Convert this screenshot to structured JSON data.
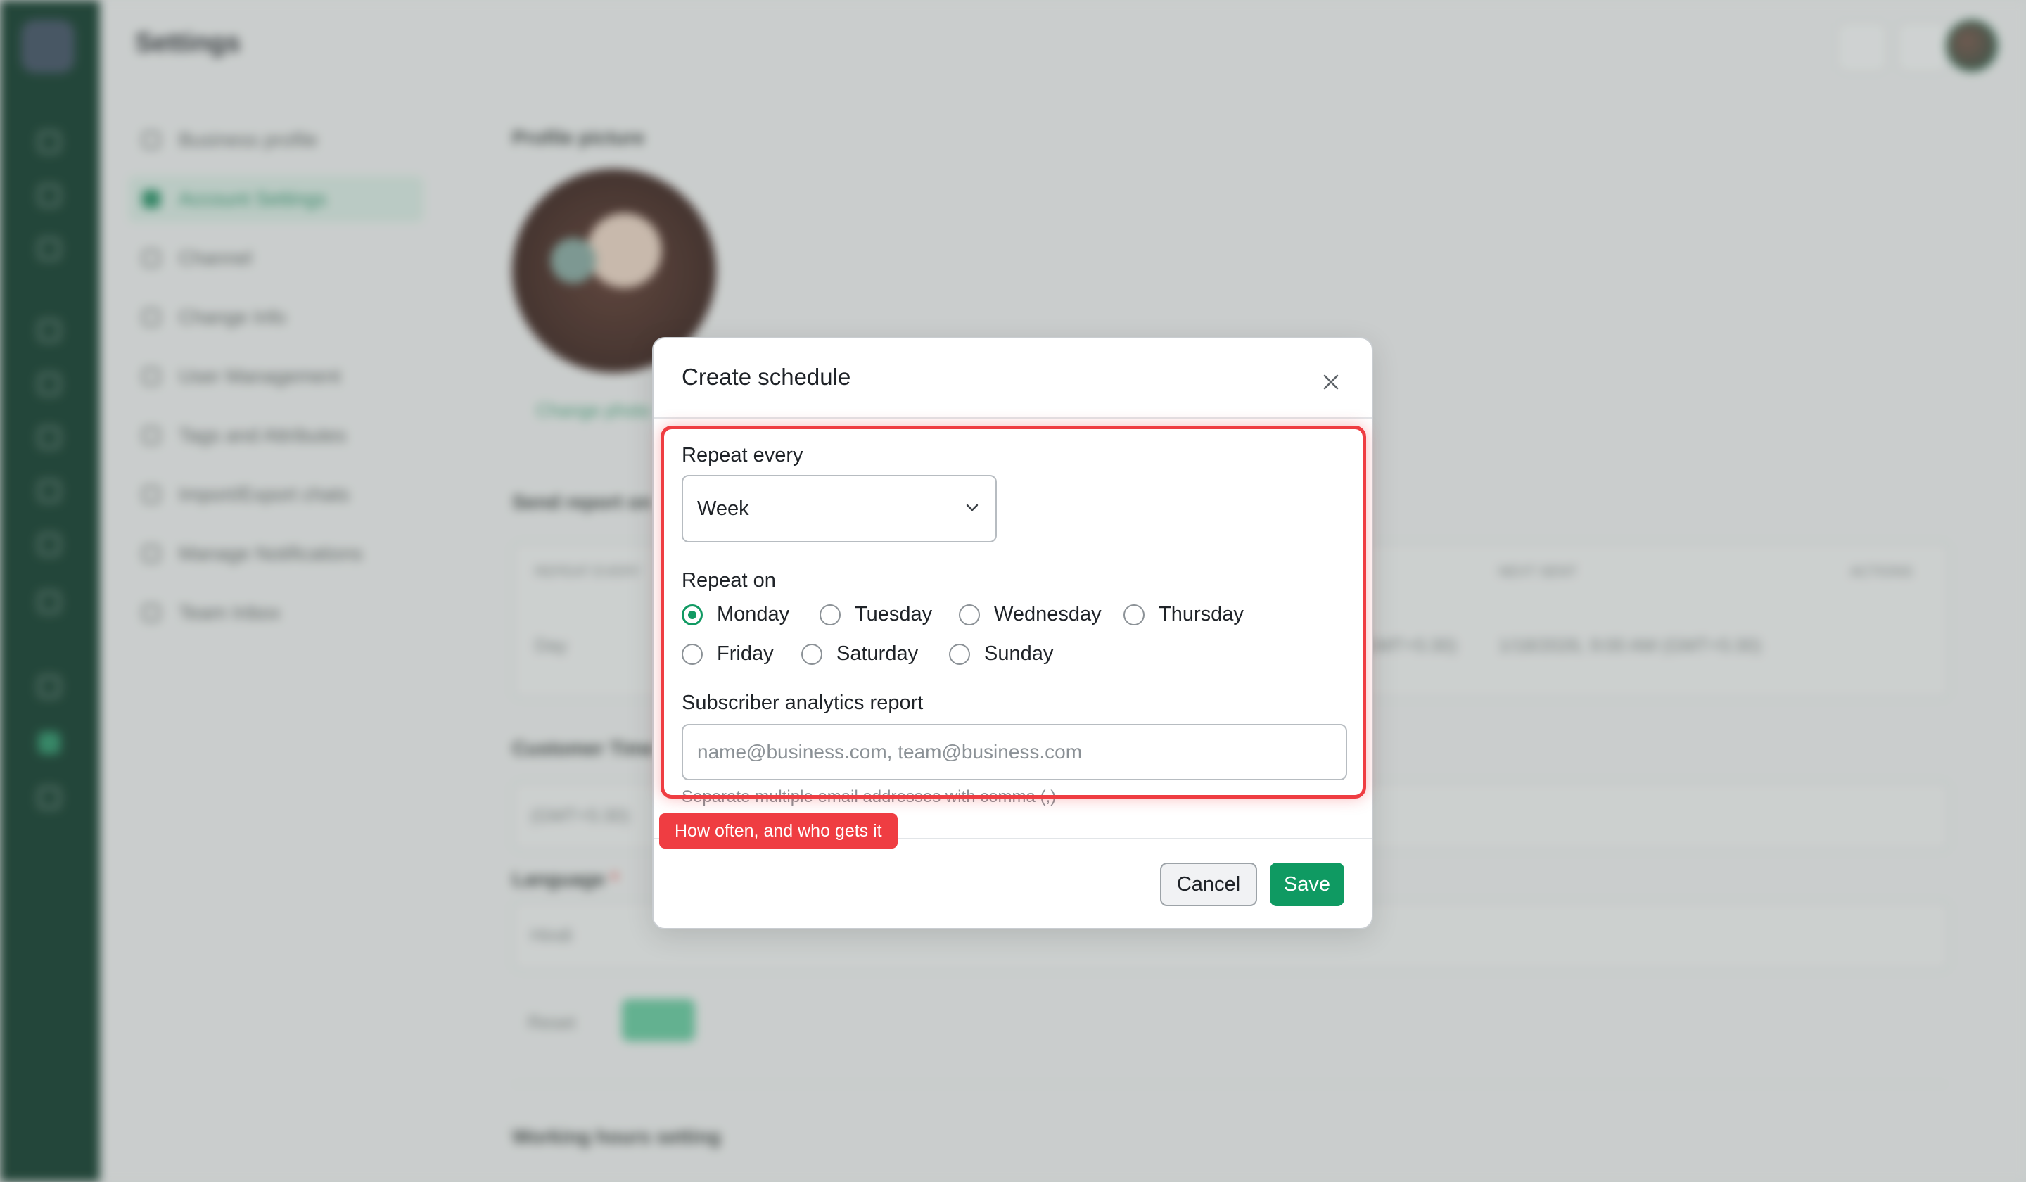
{
  "app": {
    "page_title": "Settings",
    "settings_nav": [
      {
        "label": "Business profile",
        "active": false
      },
      {
        "label": "Account Settings",
        "active": true
      },
      {
        "label": "Channel",
        "active": false
      },
      {
        "label": "Change Info",
        "active": false
      },
      {
        "label": "User Management",
        "active": false
      },
      {
        "label": "Tags and Attributes",
        "active": false
      },
      {
        "label": "Import/Export chats",
        "active": false
      },
      {
        "label": "Manage Notifications",
        "active": false
      },
      {
        "label": "Team Inbox",
        "active": false
      }
    ],
    "content": {
      "profile_picture_label": "Profile picture",
      "change_photo_label": "Change photo",
      "send_report_label": "Send report on",
      "table_headers": [
        "REPEAT EVERY",
        "NEXT SENT",
        "ACTIONS"
      ],
      "table_row": {
        "repeat": "Day",
        "last_sent": "(GMT+5:30)",
        "next_sent": "1/18/2026, 9:00 AM (GMT+5:30)"
      },
      "customer_time_label": "Customer Time",
      "customer_time_value": "(GMT+5:30)",
      "language_label": "Language",
      "language_required": "*",
      "language_value": "Hindi",
      "reset_label": "Reset",
      "save_label": "Save",
      "working_hours_label": "Working hours setting"
    }
  },
  "modal": {
    "title": "Create schedule",
    "repeat_every": {
      "label": "Repeat every",
      "value": "Week"
    },
    "repeat_on": {
      "label": "Repeat on",
      "days": [
        {
          "label": "Monday",
          "checked": true
        },
        {
          "label": "Tuesday",
          "checked": false
        },
        {
          "label": "Wednesday",
          "checked": false
        },
        {
          "label": "Thursday",
          "checked": false
        },
        {
          "label": "Friday",
          "checked": false
        },
        {
          "label": "Saturday",
          "checked": false
        },
        {
          "label": "Sunday",
          "checked": false
        }
      ]
    },
    "report": {
      "label": "Subscriber analytics report",
      "placeholder": "name@business.com, team@business.com",
      "value": "",
      "help": "Separate multiple email addresses with comma (,)"
    },
    "buttons": {
      "cancel": "Cancel",
      "save": "Save"
    }
  },
  "annotation": {
    "callout": "How often, and who gets it",
    "color": "#ef3d42"
  },
  "colors": {
    "accent": "#0f9a62",
    "rail": "#113a2b"
  }
}
